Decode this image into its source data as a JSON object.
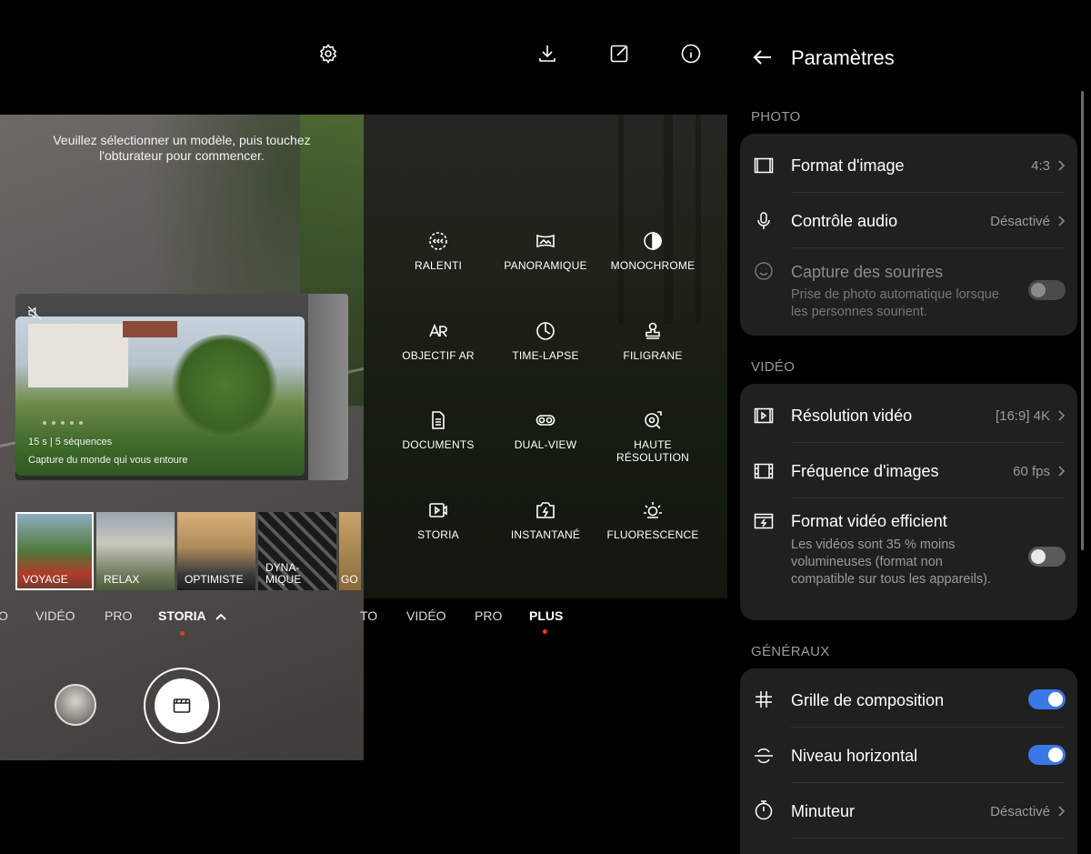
{
  "top_bar": {
    "icons": [
      "settings-gear-icon",
      "download-icon",
      "edit-icon",
      "info-icon"
    ]
  },
  "storia": {
    "instruction": "Veuillez sélectionner un modèle, puis touchez l'obturateur pour commencer.",
    "preview": {
      "duration": "15 s | 5 séquences",
      "caption": "Capture du monde qui vous entoure"
    },
    "templates": [
      {
        "label": "VOYAGE",
        "selected": true
      },
      {
        "label": "RELAX"
      },
      {
        "label": "OPTIMISTE"
      },
      {
        "label": "DYNA-\nMIQUE"
      },
      {
        "label": "GO"
      }
    ],
    "modes": {
      "left": "O",
      "m1": "VIDÉO",
      "m2": "PRO",
      "active": "STORIA"
    }
  },
  "plus": {
    "items": [
      {
        "label": "RALENTI",
        "icon": "slow-motion-icon"
      },
      {
        "label": "PANORAMIQUE",
        "icon": "panorama-icon"
      },
      {
        "label": "MONOCHROME",
        "icon": "monochrome-icon"
      },
      {
        "label": "OBJECTIF AR",
        "icon": "ar-lens-icon"
      },
      {
        "label": "TIME-LAPSE",
        "icon": "time-lapse-icon"
      },
      {
        "label": "FILIGRANE",
        "icon": "watermark-icon"
      },
      {
        "label": "DOCUMENTS",
        "icon": "documents-icon"
      },
      {
        "label": "DUAL-VIEW",
        "icon": "dual-view-icon"
      },
      {
        "label": "HAUTE\nRÉSOLUTION",
        "icon": "high-resolution-icon"
      },
      {
        "label": "STORIA",
        "icon": "storia-icon"
      },
      {
        "label": "INSTANTANÉ",
        "icon": "instant-icon"
      },
      {
        "label": "FLUORESCENCE",
        "icon": "fluorescence-icon"
      }
    ],
    "modes": {
      "left": "TO",
      "m1": "VIDÉO",
      "m2": "PRO",
      "active": "PLUS"
    }
  },
  "settings": {
    "title": "Paramètres",
    "sections": {
      "photo": "PHOTO",
      "video": "VIDÉO",
      "general": "GÉNÉRAUX"
    },
    "photo": {
      "format": {
        "label": "Format d'image",
        "value": "4:3"
      },
      "audio": {
        "label": "Contrôle audio",
        "value": "Désactivé"
      },
      "smile": {
        "label": "Capture des sourires",
        "sub": "Prise de photo automatique lorsque les personnes sourient.",
        "enabled": false
      }
    },
    "video": {
      "resolution": {
        "label": "Résolution vidéo",
        "value": "[16:9] 4K"
      },
      "fps": {
        "label": "Fréquence d'images",
        "value": "60 fps"
      },
      "efficient": {
        "label": "Format vidéo efficient",
        "sub": "Les vidéos sont 35 % moins volumineuses (format non compatible sur tous les appareils).",
        "enabled": false
      }
    },
    "general": {
      "grid": {
        "label": "Grille de composition",
        "enabled": true
      },
      "level": {
        "label": "Niveau horizontal",
        "enabled": true
      },
      "timer": {
        "label": "Minuteur",
        "value": "Désactivé"
      }
    }
  },
  "colors": {
    "toggle_on": "#3a78e6",
    "record_dot": "#e23a2e",
    "card_bg": "#202020"
  }
}
